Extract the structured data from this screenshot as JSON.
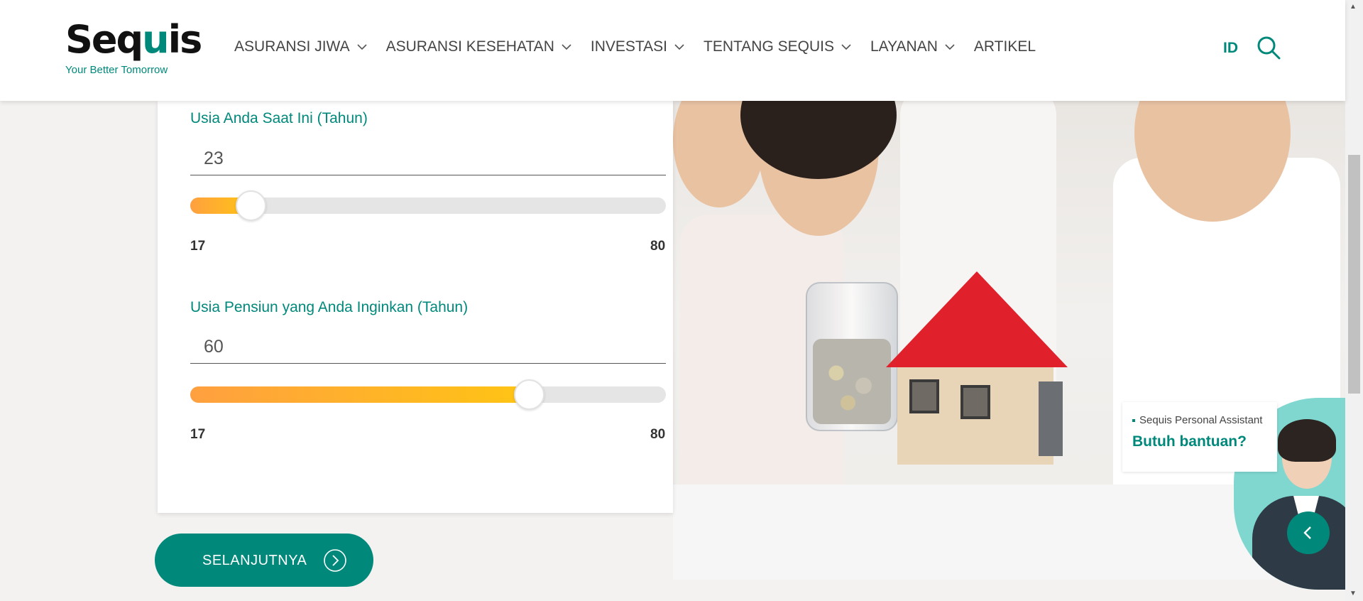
{
  "header": {
    "logo_word_pre": "Seq",
    "logo_word_accent": "u",
    "logo_word_post": "is",
    "logo_tagline": "Your Better Tomorrow",
    "nav": [
      {
        "label": "ASURANSI JIWA",
        "has_dropdown": true
      },
      {
        "label": "ASURANSI KESEHATAN",
        "has_dropdown": true
      },
      {
        "label": "INVESTASI",
        "has_dropdown": true
      },
      {
        "label": "TENTANG SEQUIS",
        "has_dropdown": true
      },
      {
        "label": "LAYANAN",
        "has_dropdown": true
      },
      {
        "label": "ARTIKEL",
        "has_dropdown": false
      }
    ],
    "language": "ID",
    "search_icon": "search-icon"
  },
  "form": {
    "current_age": {
      "label": "Usia Anda Saat Ini (Tahun)",
      "value": "23",
      "min": "17",
      "max": "80",
      "level": 0.095
    },
    "retirement_age": {
      "label": "Usia Pensiun yang Anda Inginkan (Tahun)",
      "value": "60",
      "min": "17",
      "max": "80",
      "level": 0.68
    }
  },
  "next_button": {
    "label": "SELANJUTNYA",
    "icon": "chevron-right-circle-icon"
  },
  "assistant": {
    "title": "Sequis Personal Assistant",
    "prompt": "Butuh bantuan?",
    "toggle_icon": "chevron-left-icon"
  },
  "colors": {
    "brand": "#00897b",
    "slider_start": "#ffa040",
    "slider_end": "#ffc414"
  }
}
